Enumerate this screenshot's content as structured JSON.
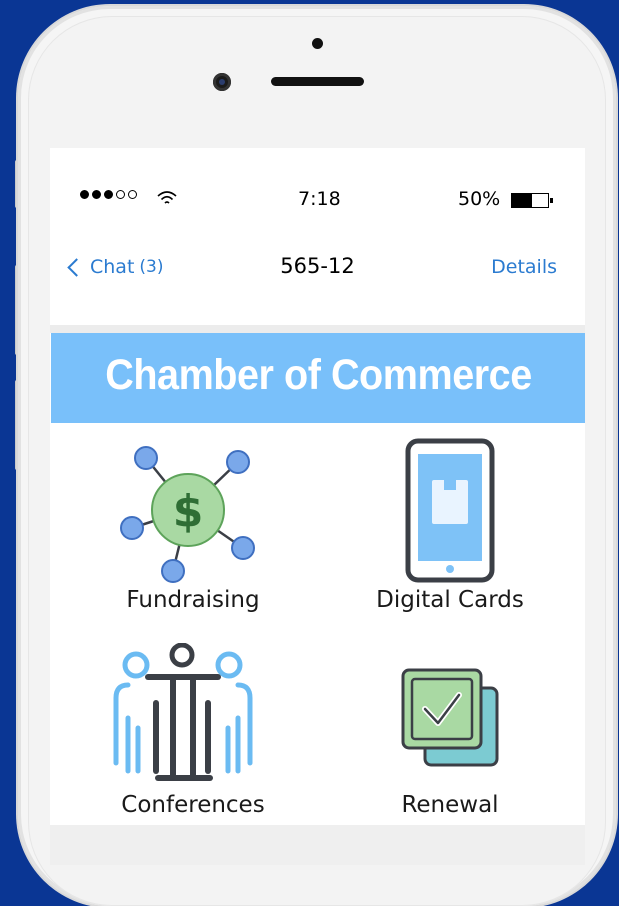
{
  "status_bar": {
    "time": "7:18",
    "battery_percent": "50%",
    "battery_level": 0.55,
    "signal_bars_filled": 3,
    "signal_bars_total": 5
  },
  "nav": {
    "back_label": "Chat",
    "back_count": "(3)",
    "title": "565-12",
    "details_label": "Details"
  },
  "banner": {
    "title": "Chamber of Commerce"
  },
  "tiles": [
    {
      "label": "Fundraising",
      "icon": "fundraising-network-dollar-icon"
    },
    {
      "label": "Digital Cards",
      "icon": "smartphone-card-icon"
    },
    {
      "label": "Conferences",
      "icon": "conference-people-icon"
    },
    {
      "label": "Renewal",
      "icon": "checkbox-renewal-icon"
    }
  ],
  "colors": {
    "background": "#0a3694",
    "banner": "#79c0fa",
    "link": "#2b7bd0",
    "icon_blue": "#7aa8ea",
    "icon_green": "#a9d9a3",
    "icon_dark": "#3b3f46"
  }
}
